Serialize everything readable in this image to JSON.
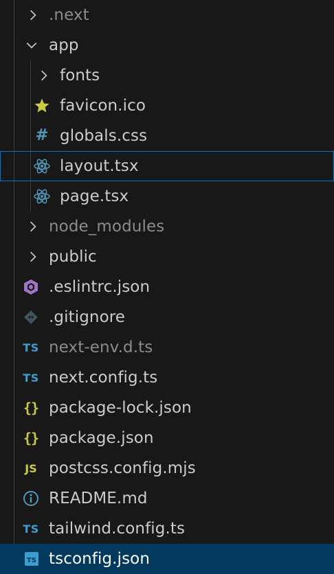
{
  "explorer": {
    "accent": "#0078d4",
    "selected_bg": "#04395e",
    "items": [
      {
        "label": ".next",
        "kind": "folder",
        "state": "collapsed",
        "depth": 1,
        "dim": true,
        "icon": "chevron-right-icon"
      },
      {
        "label": "app",
        "kind": "folder",
        "state": "expanded",
        "depth": 1,
        "icon": "chevron-down-icon"
      },
      {
        "label": "fonts",
        "kind": "folder",
        "state": "collapsed",
        "depth": 2,
        "icon": "chevron-right-icon"
      },
      {
        "label": "favicon.ico",
        "kind": "file",
        "depth": 2,
        "icon": "star-icon",
        "icon_color": "#cbcb41"
      },
      {
        "label": "globals.css",
        "kind": "file",
        "depth": 2,
        "icon": "hash-icon",
        "icon_color": "#519aba"
      },
      {
        "label": "layout.tsx",
        "kind": "file",
        "depth": 2,
        "icon": "react-icon",
        "icon_color": "#519aba",
        "focused": true
      },
      {
        "label": "page.tsx",
        "kind": "file",
        "depth": 2,
        "icon": "react-icon",
        "icon_color": "#519aba"
      },
      {
        "label": "node_modules",
        "kind": "folder",
        "state": "collapsed",
        "depth": 1,
        "dim": true,
        "icon": "chevron-right-icon"
      },
      {
        "label": "public",
        "kind": "folder",
        "state": "collapsed",
        "depth": 1,
        "icon": "chevron-right-icon"
      },
      {
        "label": ".eslintrc.json",
        "kind": "file",
        "depth": 1,
        "icon": "eslint-icon",
        "icon_color": "#a074c4"
      },
      {
        "label": ".gitignore",
        "kind": "file",
        "depth": 1,
        "icon": "git-icon",
        "icon_color": "#41535b"
      },
      {
        "label": "next-env.d.ts",
        "kind": "file",
        "depth": 1,
        "dim": true,
        "icon": "typescript-icon",
        "icon_color": "#3c9dd0"
      },
      {
        "label": "next.config.ts",
        "kind": "file",
        "depth": 1,
        "icon": "typescript-icon",
        "icon_color": "#3c9dd0"
      },
      {
        "label": "package-lock.json",
        "kind": "file",
        "depth": 1,
        "icon": "json-icon",
        "icon_color": "#cbcb41"
      },
      {
        "label": "package.json",
        "kind": "file",
        "depth": 1,
        "icon": "json-icon",
        "icon_color": "#cbcb41"
      },
      {
        "label": "postcss.config.mjs",
        "kind": "file",
        "depth": 1,
        "icon": "javascript-icon",
        "icon_color": "#cbcb41"
      },
      {
        "label": "README.md",
        "kind": "file",
        "depth": 1,
        "icon": "info-icon",
        "icon_color": "#519aba"
      },
      {
        "label": "tailwind.config.ts",
        "kind": "file",
        "depth": 1,
        "icon": "typescript-icon",
        "icon_color": "#3c9dd0"
      },
      {
        "label": "tsconfig.json",
        "kind": "file",
        "depth": 1,
        "icon": "tsconfig-icon",
        "icon_color": "#3c9dd0",
        "selected": true
      }
    ]
  }
}
